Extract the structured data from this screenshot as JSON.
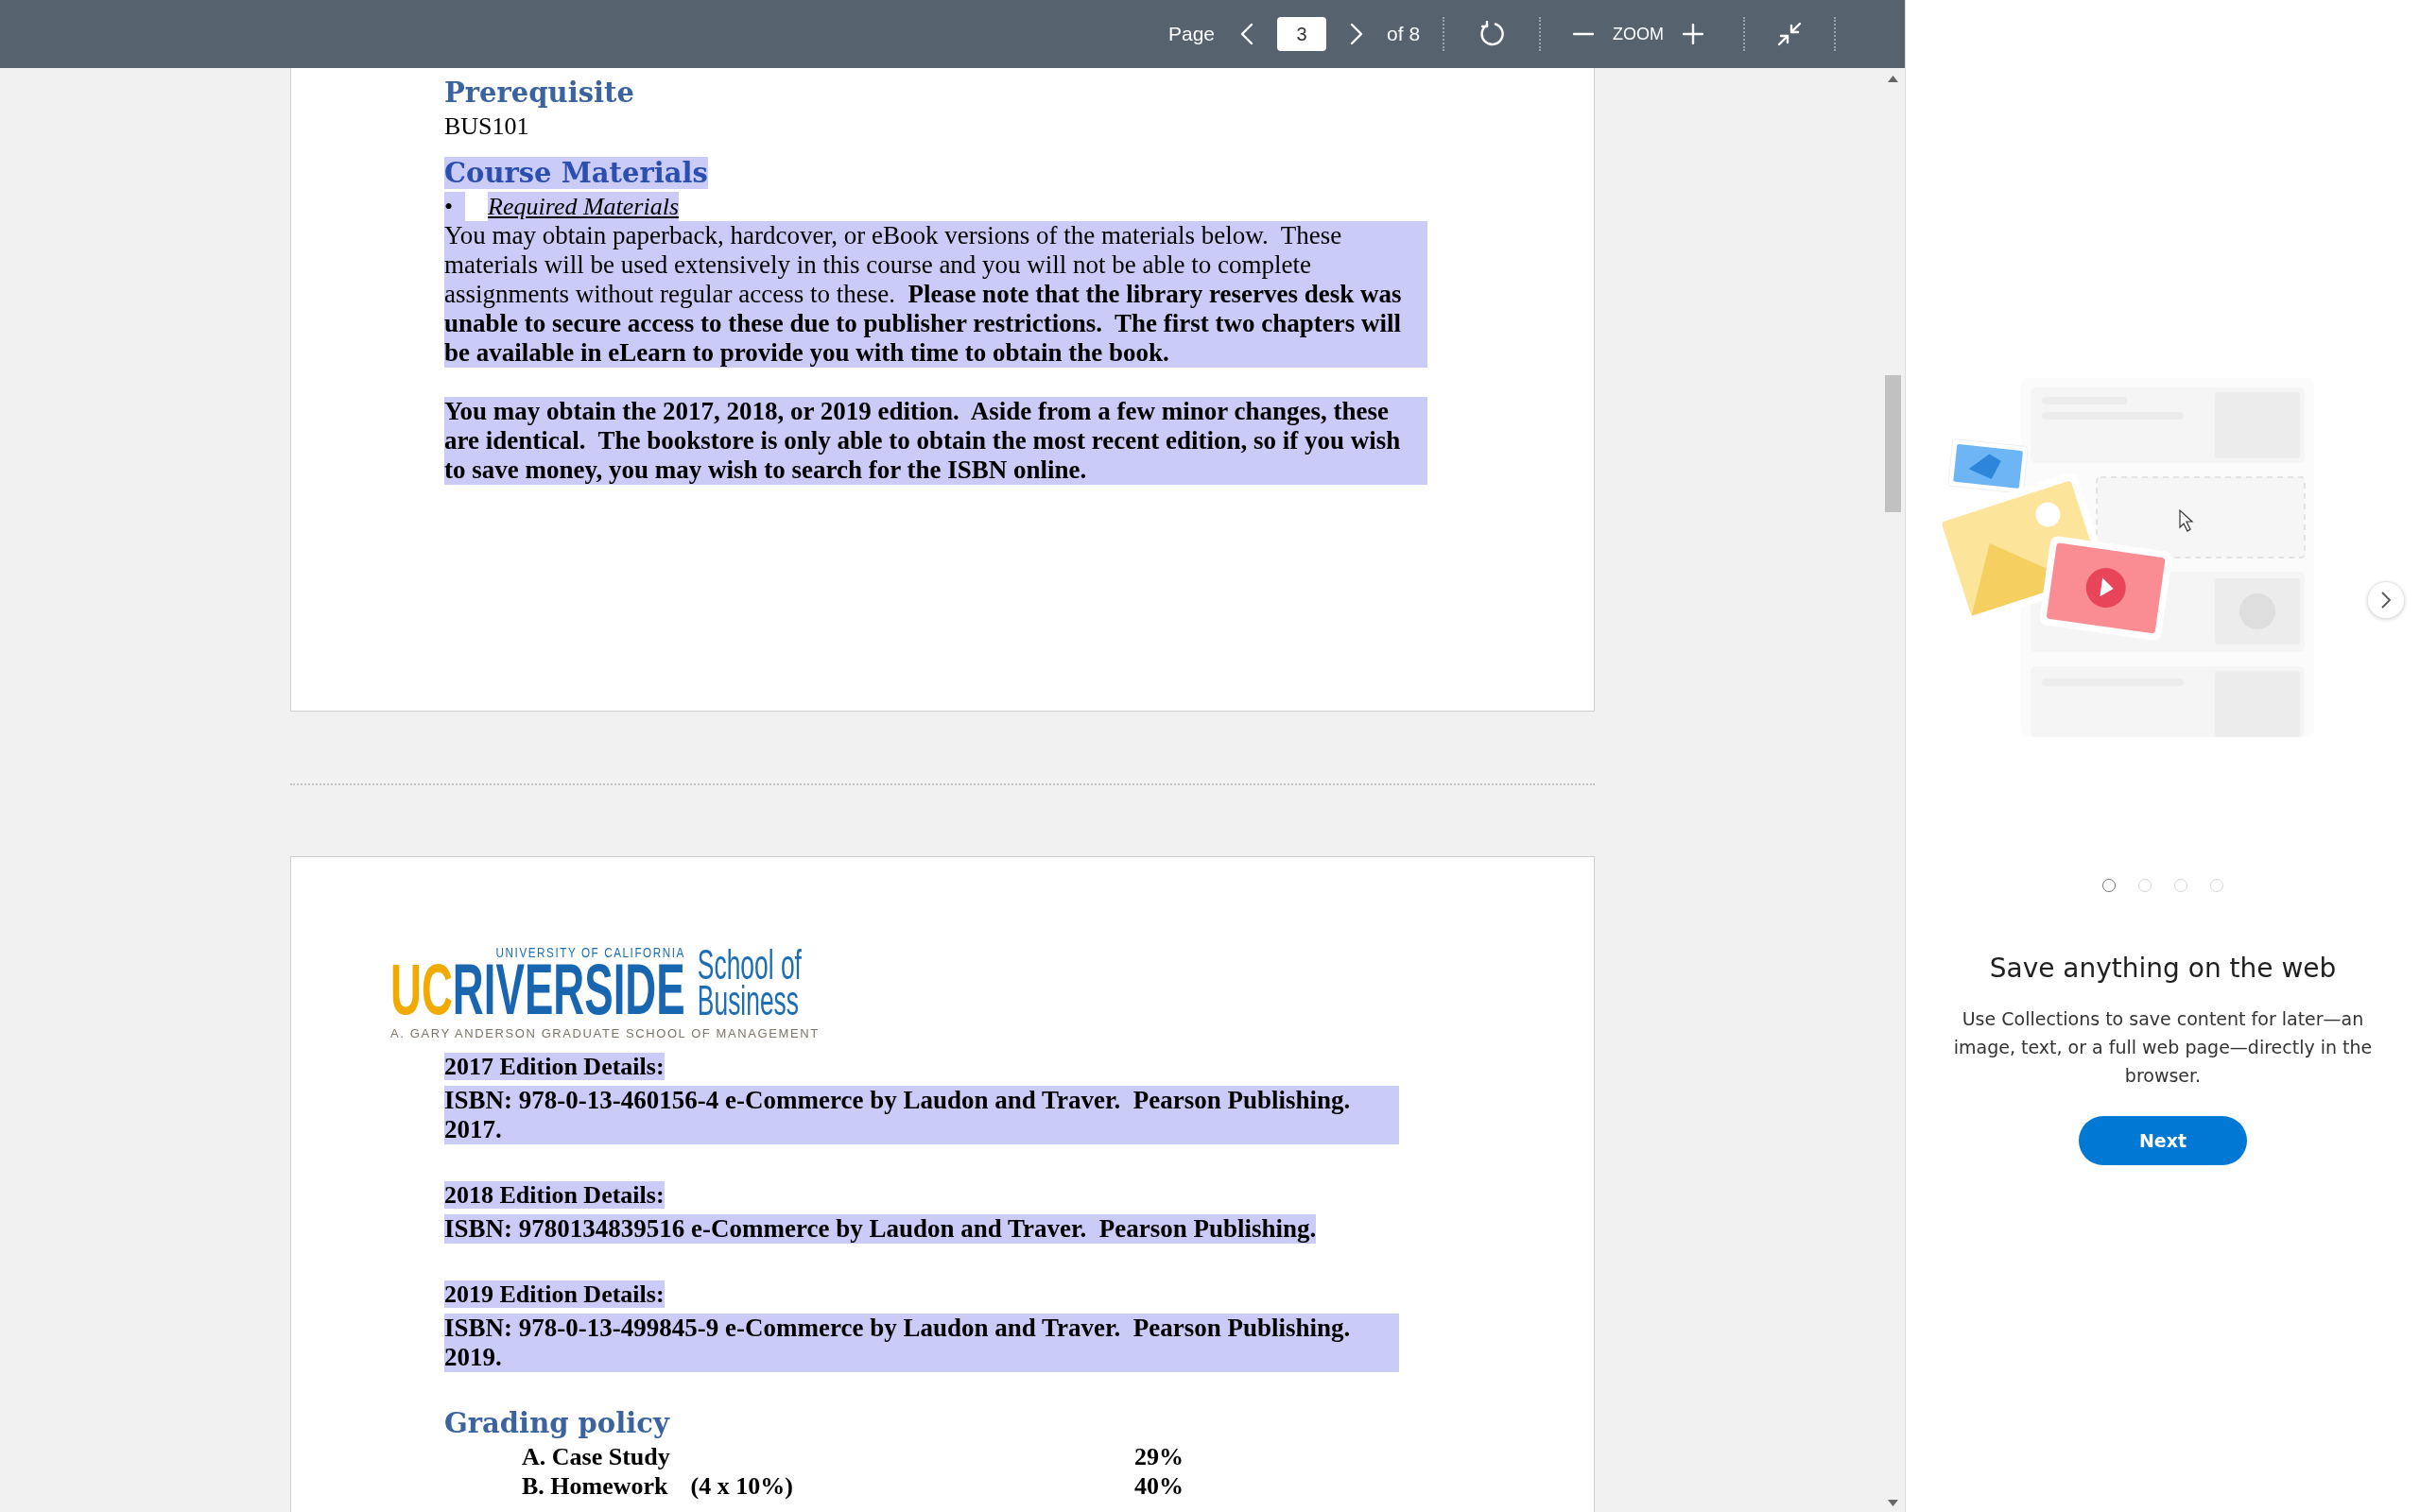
{
  "toolbar": {
    "page_label": "Page",
    "page_number": "3",
    "page_total": "of 8",
    "zoom_label": "ZOOM"
  },
  "page_1": {
    "blocks": [
      {
        "kind": "heading",
        "text": "Prerequisite",
        "highlighted": false
      },
      {
        "kind": "text",
        "text": "BUS101",
        "highlighted": false
      },
      {
        "kind": "heading",
        "text": "Course Materials",
        "highlighted": true
      },
      {
        "kind": "bullet",
        "bullet": "•",
        "text": "Required Materials",
        "highlighted": true
      },
      {
        "kind": "paragraph",
        "text": "You may obtain paperback, hardcover, or eBook versions of the materials below.  These materials will be used extensively in this course and you will not be able to complete assignments without regular access to these.  **Please note that the library reserves desk was unable to secure access to these due to publisher restrictions.  The first two chapters will be available in eLearn to provide you with time to obtain the book.**",
        "bold": false,
        "highlighted": true
      },
      {
        "kind": "paragraph",
        "text": "You may obtain the 2017, 2018, or 2019 edition.  Aside from a few minor changes, these are identical.  The bookstore is only able to obtain the most recent edition, so if you wish to save money, you may wish to search for the ISBN online.",
        "bold": true,
        "highlighted": true
      }
    ]
  },
  "page_2": {
    "logo": {
      "uc": "UC",
      "university": "UNIVERSITY OF CALIFORNIA",
      "riverside": "RIVERSIDE",
      "school": "School of",
      "business": "Business",
      "tagline": "A. GARY ANDERSON GRADUATE SCHOOL OF MANAGEMENT"
    },
    "blocks": [
      {
        "kind": "label",
        "text": "2017 Edition Details:",
        "highlighted": true
      },
      {
        "kind": "paragraph",
        "text": "ISBN: 978-0-13-460156-4 e-Commerce by Laudon and Traver.  Pearson Publishing.  2017.",
        "bold": true,
        "highlighted": true
      },
      {
        "kind": "label",
        "text": "2018 Edition Details:",
        "highlighted": true
      },
      {
        "kind": "paragraph",
        "text": "ISBN: 9780134839516 e-Commerce by Laudon and Traver.  Pearson Publishing.",
        "bold": true,
        "highlighted": true
      },
      {
        "kind": "label",
        "text": "2019 Edition Details:",
        "highlighted": true
      },
      {
        "kind": "paragraph",
        "text": "ISBN: 978-0-13-499845-9 e-Commerce by Laudon and Traver.  Pearson Publishing.  2019.",
        "bold": true,
        "highlighted": true
      },
      {
        "kind": "heading",
        "text": "Grading policy",
        "highlighted": false
      }
    ],
    "grading": [
      {
        "item": "A. Case Study",
        "percent": "29%"
      },
      {
        "item": "B. Homework",
        "detail": "(4 x 10%)",
        "percent": "40%"
      }
    ]
  },
  "sidebar": {
    "dots": [
      {
        "selected": true
      },
      {
        "selected": false
      },
      {
        "selected": false
      },
      {
        "selected": false
      }
    ],
    "title": "Save anything on the web",
    "description": "Use Collections to save content for later—an image, text, or a full web page—directly in the browser.",
    "button": "Next"
  }
}
